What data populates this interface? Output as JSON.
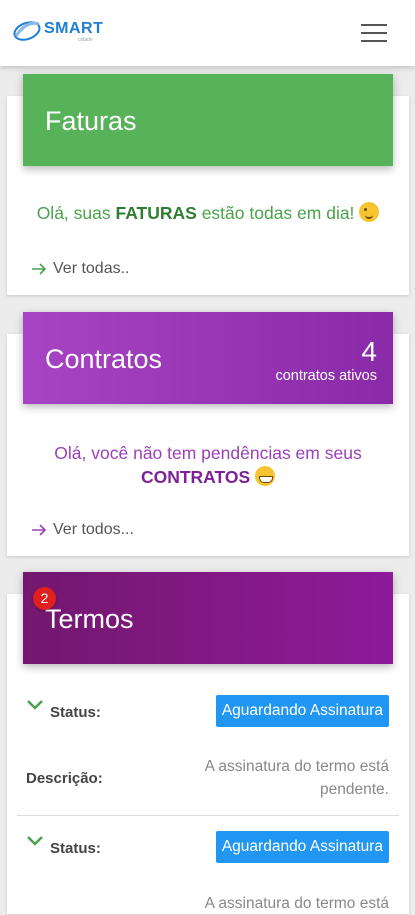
{
  "header": {
    "logo_text": "SMART",
    "logo_subtext": "cidade",
    "menu_icon": "hamburger-menu-icon"
  },
  "faturas": {
    "title": "Faturas",
    "message_prefix": "Olá, suas ",
    "message_bold": "FATURAS",
    "message_suffix": " estão todas em dia! ",
    "emoji": "wink-emoji",
    "link": "Ver todas.."
  },
  "contratos": {
    "title": "Contratos",
    "count": "4",
    "count_label": "contratos ativos",
    "message_line1": "Olá, você não tem pendências em seus",
    "message_bold": "CONTRATOS",
    "emoji": "grin-emoji",
    "link": "Ver todos..."
  },
  "termos": {
    "title": "Termos",
    "badge": "2",
    "items": [
      {
        "status_label": "Status:",
        "status_value": "Aguardando Assinatura",
        "desc_label": "Descrição:",
        "desc_text": "A assinatura do termo está pendente."
      },
      {
        "status_label": "Status:",
        "status_value": "Aguardando Assinatura",
        "desc_text_partial": "A assinatura do termo está"
      }
    ]
  },
  "colors": {
    "faturas": "#57b259",
    "contratos": "#a744c4",
    "termos": "#8e1a9a",
    "status_button": "#2196f3",
    "badge": "#e01f1f"
  }
}
